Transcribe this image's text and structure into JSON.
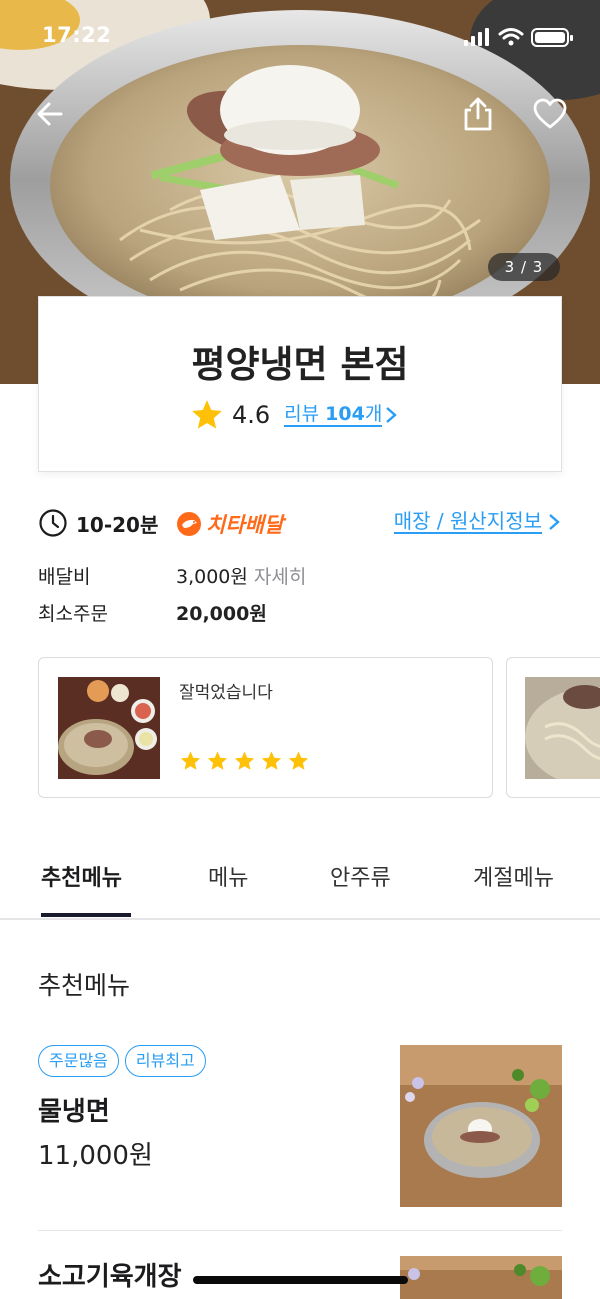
{
  "status_bar": {
    "time": "17:22"
  },
  "header": {
    "photo_counter": "3 / 3",
    "icons": [
      "back-arrow-icon",
      "share-icon",
      "heart-icon"
    ]
  },
  "store": {
    "name": "평양냉면 본점",
    "rating": "4.6",
    "review_link": {
      "prefix": "리뷰 ",
      "count": "104",
      "suffix": "개"
    }
  },
  "delivery": {
    "time": "10-20분",
    "service_badge": "치타배달",
    "origin_link": {
      "left": "매장",
      "sep": " / ",
      "right": "원산지정보"
    },
    "fee_label": "배달비",
    "fee_value": "3,000원",
    "fee_detail": "자세히",
    "min_order_label": "최소주문",
    "min_order_value": "20,000원"
  },
  "reviews": [
    {
      "text": "잘먹었습니다",
      "stars": 5
    }
  ],
  "tabs": [
    {
      "label": "추천메뉴",
      "active": true
    },
    {
      "label": "메뉴",
      "active": false
    },
    {
      "label": "안주류",
      "active": false
    },
    {
      "label": "계절메뉴",
      "active": false
    }
  ],
  "section": {
    "title": "추천메뉴"
  },
  "menu_items": [
    {
      "badges": [
        "주문많음",
        "리뷰최고"
      ],
      "name": "물냉면",
      "price": "11,000원"
    },
    {
      "badges": [],
      "name": "소고기육개장",
      "price": ""
    }
  ],
  "colors": {
    "accent": "#2a9df4",
    "star": "#ffc107",
    "cheetah": "#ff6a1a",
    "tab_indicator": "#1a1a2e"
  }
}
